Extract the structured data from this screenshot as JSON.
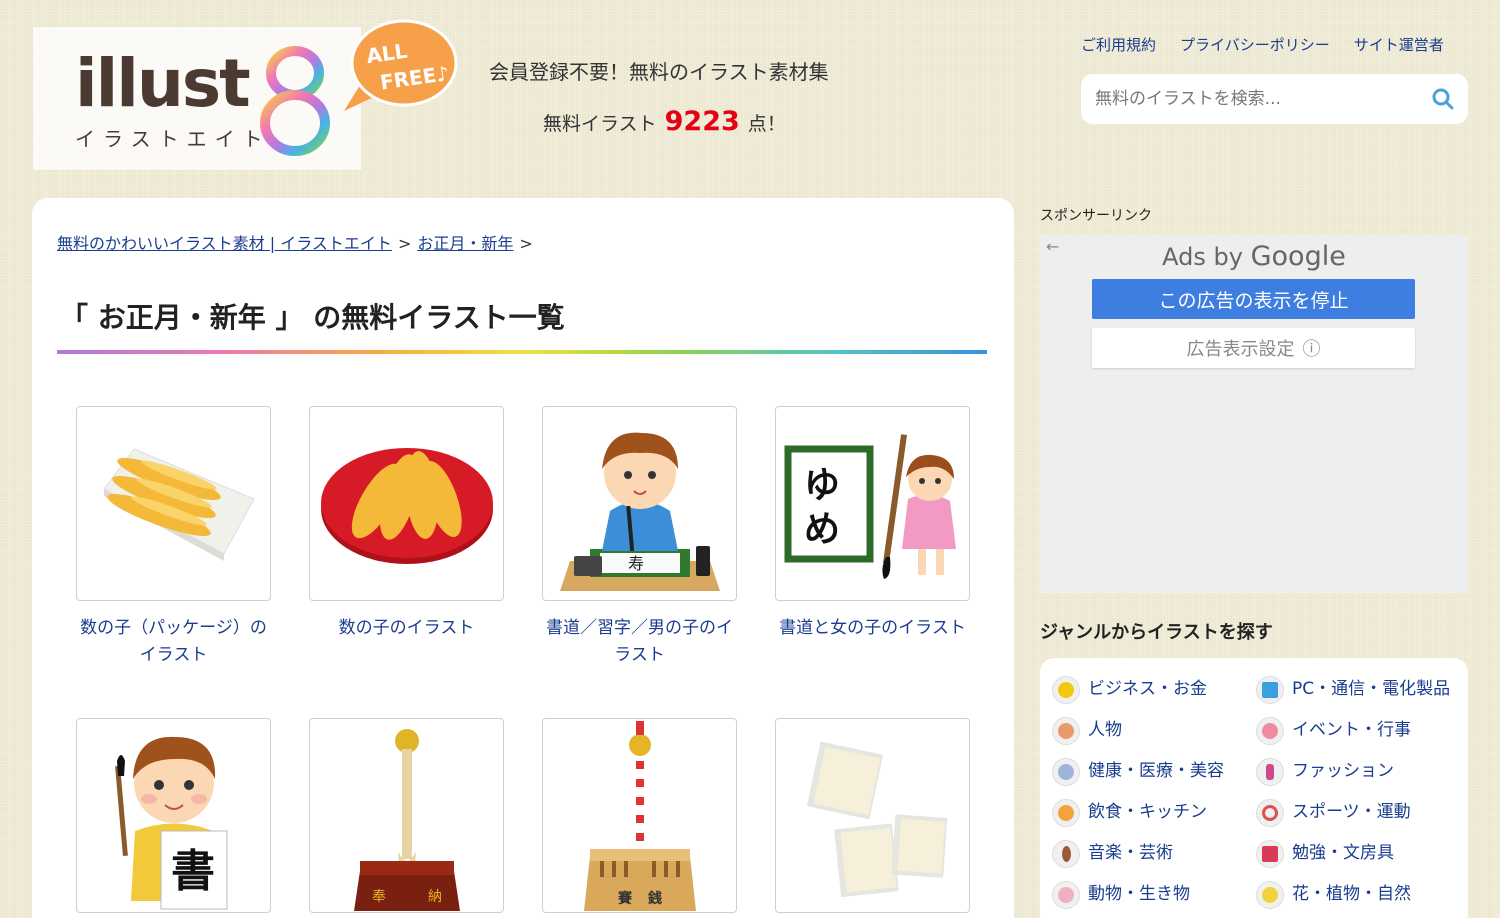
{
  "header": {
    "logo": {
      "main": "illust",
      "sub": "イラストエイト",
      "eight": "8",
      "bubble_line1": "ALL",
      "bubble_line2": "FREE♪"
    },
    "tagline": "会員登録不要！無料のイラスト素材集",
    "count_prefix": "無料イラスト",
    "count_value": "9223",
    "count_suffix": "点！",
    "links": [
      "ご利用規約",
      "プライバシーポリシー",
      "サイト運営者"
    ],
    "search_placeholder": "無料のイラストを検索..."
  },
  "breadcrumb": {
    "home": "無料のかわいいイラスト素材 | イラストエイト",
    "sep": ">",
    "category": "お正月・新年"
  },
  "page_title": "「 お正月・新年 」 の無料イラスト一覧",
  "cards": [
    {
      "title": "数の子（パッケージ）のイラスト",
      "icon": "kazunoko-package-icon"
    },
    {
      "title": "数の子のイラスト",
      "icon": "kazunoko-plate-icon"
    },
    {
      "title": "書道／習字／男の子のイラスト",
      "icon": "calligraphy-boy-icon"
    },
    {
      "title": "書道と女の子のイラスト",
      "icon": "calligraphy-girl-icon"
    },
    {
      "title": "",
      "icon": "boy-calligraphy-sho-icon"
    },
    {
      "title": "",
      "icon": "shrine-bell-offering-icon"
    },
    {
      "title": "",
      "icon": "offering-box-bell-icon"
    },
    {
      "title": "",
      "icon": "rice-cake-icon"
    }
  ],
  "sidebar": {
    "sponsor_label": "スポンサーリンク",
    "ad": {
      "back": "←",
      "ads_by": "Ads by",
      "google": "Google",
      "stop_label": "この広告の表示を停止",
      "settings_label": "広告表示設定",
      "info": "ⓘ"
    },
    "genre_heading": "ジャンルからイラストを探す",
    "genres": [
      {
        "label": "ビジネス・お金",
        "color": "#f2c80f"
      },
      {
        "label": "PC・通信・電化製品",
        "color": "#3aa0e0"
      },
      {
        "label": "人物",
        "color": "#e89a6a"
      },
      {
        "label": "イベント・行事",
        "color": "#f08aa0"
      },
      {
        "label": "健康・医療・美容",
        "color": "#9fb4d8"
      },
      {
        "label": "ファッション",
        "color": "#d04a8a"
      },
      {
        "label": "飲食・キッチン",
        "color": "#f2a33a"
      },
      {
        "label": "スポーツ・運動",
        "color": "#e05050"
      },
      {
        "label": "音楽・芸術",
        "color": "#9a5a3a"
      },
      {
        "label": "勉強・文房具",
        "color": "#d83a5a"
      },
      {
        "label": "動物・生き物",
        "color": "#f0b0c0"
      },
      {
        "label": "花・植物・自然",
        "color": "#f2d23a"
      }
    ]
  }
}
